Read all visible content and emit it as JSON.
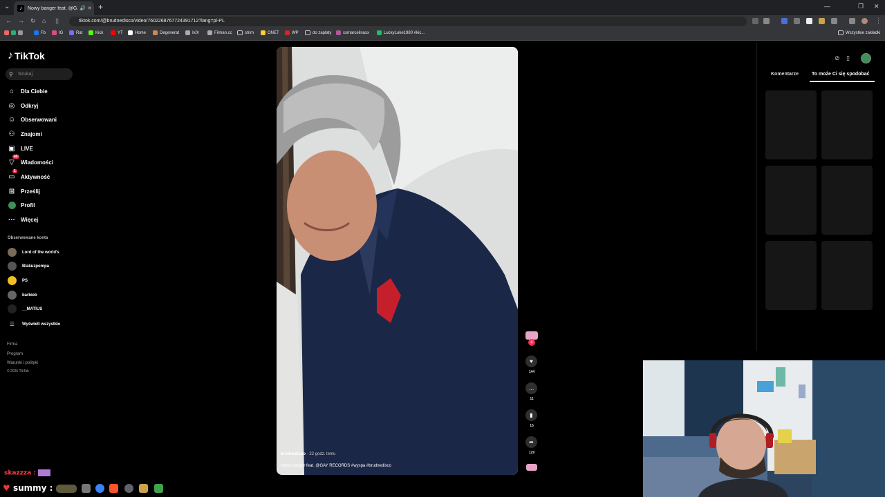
{
  "browser": {
    "tab_title": "Nowy banger feat. @GAY R",
    "url": "tiktok.com/@brudnedisco/video/7602268767724391712?lang=pl-PL",
    "bookmarks": [
      "Fb",
      "IG",
      "Rat",
      "Kick",
      "YT",
      "Home",
      "Degenerat",
      "Ix0r",
      "Filman.cc",
      "strim",
      "ONET",
      "WP",
      "do zaplaty",
      "xxmarcelinaxx",
      "LuckyLuke1980 #kic...",
      "Wszystkie zakładki"
    ]
  },
  "tiktok": {
    "brand": "TikTok",
    "search_placeholder": "Szukaj",
    "nav": [
      {
        "label": "Dla Ciebie",
        "icon": "home-icon"
      },
      {
        "label": "Odkryj",
        "icon": "compass-icon"
      },
      {
        "label": "Obserwowani",
        "icon": "user-follow-icon"
      },
      {
        "label": "Znajomi",
        "icon": "friends-icon"
      },
      {
        "label": "LIVE",
        "icon": "live-icon"
      },
      {
        "label": "Wiadomości",
        "icon": "message-icon",
        "badge": "45"
      },
      {
        "label": "Aktywność",
        "icon": "activity-icon",
        "badge": "1"
      },
      {
        "label": "Prześlij",
        "icon": "upload-icon"
      },
      {
        "label": "Profil",
        "icon": "profile-icon"
      },
      {
        "label": "Więcej",
        "icon": "more-icon"
      }
    ],
    "followed_label": "Obserwowane konta",
    "followed": [
      "Lord of the world's",
      "Blakuzpompa",
      "PS",
      "barbieb",
      "__MATIUS"
    ],
    "show_all": "Wyświetl wszystkie",
    "footer": [
      "Firma",
      "Program",
      "Warunki i polityki",
      "© 2026 TikTok"
    ],
    "video": {
      "author": "brudnedisco",
      "time": "· 22 godz. temu",
      "caption": "Nowy banger feat. @GAY RECORDS #wyspa #brudnedisco",
      "likes": "144",
      "comments": "11",
      "saves": "15",
      "shares": "129"
    },
    "right_tabs": [
      "Komentarze",
      "To może Ci się spodobać"
    ]
  },
  "overlay": {
    "chat_line_1": "skazzza :",
    "chat_line_2": "summy :"
  }
}
